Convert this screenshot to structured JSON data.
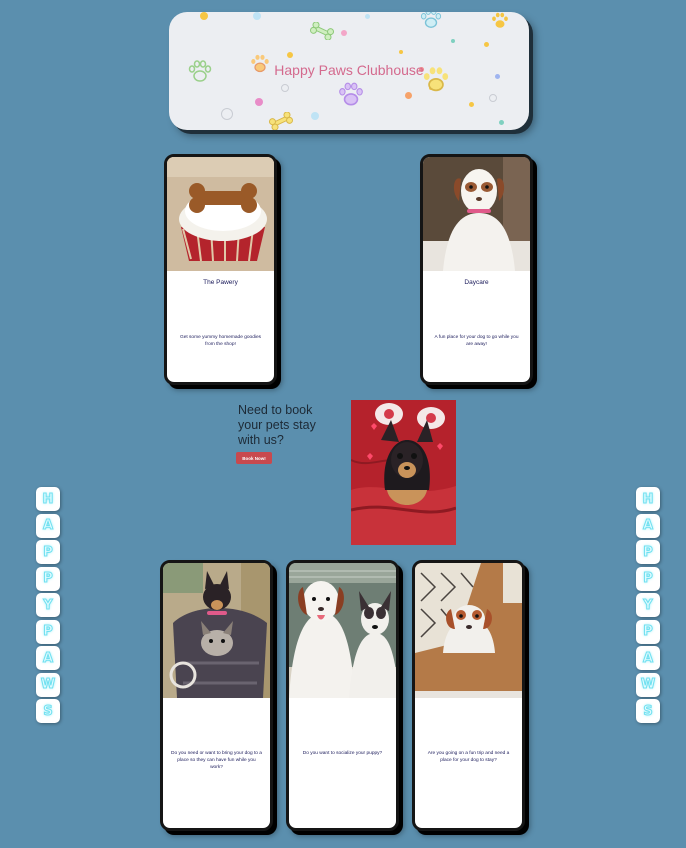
{
  "banner": {
    "title": "Happy Paws Clubhouse"
  },
  "colors": {
    "background": "#5b8fae",
    "accent": "#d46a8e",
    "button": "#c8494e",
    "letter": "#6fe0f0"
  },
  "cards_top": [
    {
      "title": "The Pawery",
      "description": "Get some yummy homemade goodies from the shop!"
    },
    {
      "title": "Daycare",
      "description": "A fun place for your dog to go while you are away!"
    }
  ],
  "booking": {
    "text": "Need to book your pets stay with us?",
    "button_label": "Book Now!"
  },
  "cards_bottom": [
    {
      "description": "Do you need or want to bring your dog to a place so they can have fun while you work?"
    },
    {
      "description": "Do you want to socialize your puppy?"
    },
    {
      "description": "Are you going on a fun trip and need a place for your dog to stay?"
    }
  ],
  "side_letters": [
    "H",
    "A",
    "P",
    "P",
    "Y",
    "P",
    "A",
    "W",
    "S"
  ]
}
